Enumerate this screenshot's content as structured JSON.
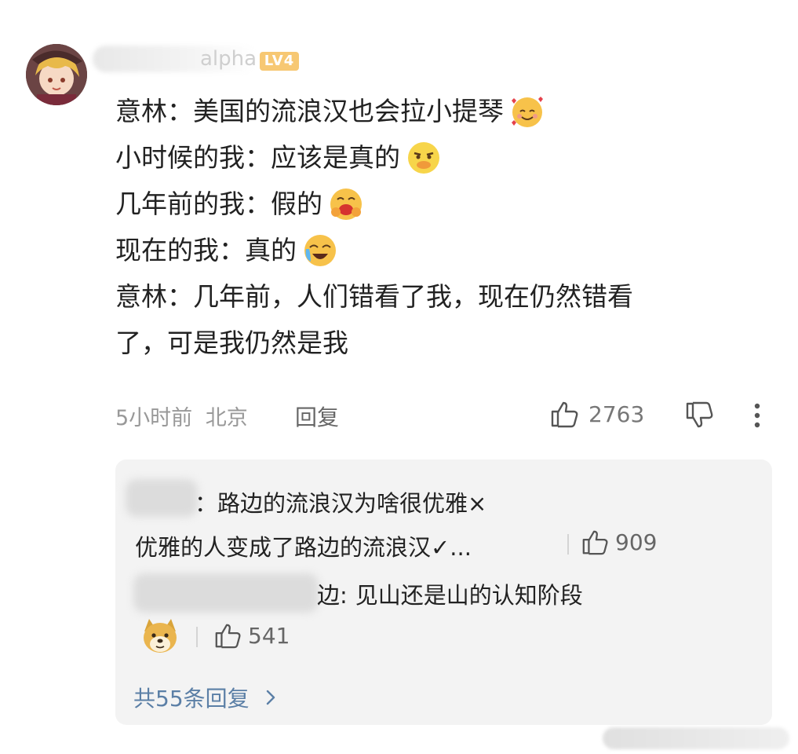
{
  "comment": {
    "username_partial": "alpha",
    "level": "LV4",
    "lines": [
      "意林：美国的流浪汉也会拉小提琴",
      "小时候的我：应该是真的",
      "几年前的我：假的",
      "现在的我：真的",
      "意林：几年前，人们错看了我，现在仍然错看",
      "了，可是我仍然是我"
    ],
    "emoji_names": [
      "smiling-hearts",
      "squint-skeptical",
      "laughing-hands",
      "crying-laughing"
    ],
    "time": "5小时前",
    "location": "北京",
    "reply_label": "回复",
    "likes": "2763"
  },
  "replies": [
    {
      "name_suffix": "：",
      "text_line1": "路边的流浪汉为啥很优雅×",
      "text_line2": "优雅的人变成了路边的流浪汉✓...",
      "likes": "909"
    },
    {
      "name_suffix": "边:",
      "text_line1": "见山还是山的认知阶段",
      "emoji_name": "doge",
      "likes": "541"
    }
  ],
  "total_replies_label": "共55条回复"
}
